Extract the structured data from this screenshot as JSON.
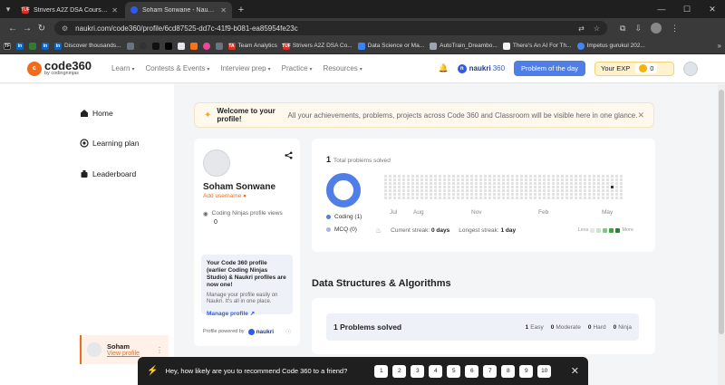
{
  "browser": {
    "tabs": [
      {
        "title": "Strivers A2Z DSA Course/Sheet",
        "favicon_text": "TUF",
        "color": "#d93025",
        "active": false
      },
      {
        "title": "Soham Sonwane - Naukri Code 360",
        "favicon_text": "",
        "color": "#2f5bea",
        "active": true
      }
    ],
    "url": "naukri.com/code360/profile/6cd87525-dd7c-41f9-b081-ea85954fe23c",
    "bookmarks": [
      {
        "label": "Discover thousands...",
        "icon_text": "in",
        "color": "#0a66c2"
      },
      {
        "label": "Team Analytics",
        "icon_text": "TA",
        "color": "#d93025"
      },
      {
        "label": "Strivers A2Z DSA Co...",
        "icon_text": "TUF",
        "color": "#d93025"
      },
      {
        "label": "Data Science or Ma...",
        "icon_text": "",
        "color": "#3b82f6"
      },
      {
        "label": "AutoTrain_Dreambo...",
        "icon_text": "",
        "color": "#9ca3af"
      },
      {
        "label": "There's An AI For Th...",
        "icon_text": "",
        "color": "#f3f4f6"
      },
      {
        "label": "Impetus gurukul 202...",
        "icon_text": "",
        "color": "#4285f4"
      }
    ]
  },
  "header": {
    "logo_main": "code360",
    "logo_sub": "by codingninjas",
    "logo_mark": "c",
    "nav": [
      "Learn",
      "Contests & Events",
      "Interview prep",
      "Practice",
      "Resources"
    ],
    "naukri_label": "naukri",
    "naukri_suffix": "360",
    "potd": "Problem of the day",
    "exp_label": "Your EXP",
    "exp_value": "0"
  },
  "sidebar": {
    "items": [
      "Home",
      "Learning plan",
      "Leaderboard"
    ],
    "user_name": "Soham",
    "view_profile": "View profile"
  },
  "welcome": {
    "title": "Welcome to your profile!",
    "message": "All your achievements, problems, projects across Code 360 and Classroom will be visible here in one glance."
  },
  "profile": {
    "name": "Soham Sonwane",
    "add_username": "Add username",
    "views_label": "Coding Ninjas profile views",
    "views_count": "0",
    "promo_heading": "Your Code 360 profile (earlier Coding Ninjas Studio) & Naukri profiles are now one!",
    "promo_text": "Manage your profile easily on Naukri. It's all in one place.",
    "promo_link": "Manage profile",
    "powered_by": "Profile powered by",
    "powered_brand": "naukri"
  },
  "stats": {
    "count": "1",
    "label": "Total problems solved",
    "legend": [
      {
        "label": "Coding (1)",
        "color": "#4f7ee6"
      },
      {
        "label": "MCQ (0)",
        "color": "#a7b6d8"
      }
    ],
    "months": [
      "Jul",
      "Aug",
      "Nov",
      "Feb",
      "May"
    ],
    "current_streak_label": "Current streak:",
    "current_streak": "0 days",
    "longest_streak_label": "Longest streak:",
    "longest_streak": "1 day",
    "less": "Less",
    "more": "More",
    "heat_colors": [
      "#e6e6e6",
      "#c8e6c9",
      "#81c784",
      "#43a047",
      "#2e7d32"
    ]
  },
  "dsa": {
    "title": "Data Structures & Algorithms",
    "solved": "1 Problems solved",
    "levels": [
      {
        "count": "1",
        "label": "Easy"
      },
      {
        "count": "0",
        "label": "Moderate"
      },
      {
        "count": "0",
        "label": "Hard"
      },
      {
        "count": "0",
        "label": "Ninja"
      }
    ]
  },
  "feedback": {
    "question": "Hey, how likely are you to recommend Code 360 to a friend?",
    "scores": [
      "1",
      "2",
      "3",
      "4",
      "5",
      "6",
      "7",
      "8",
      "9",
      "10"
    ]
  }
}
